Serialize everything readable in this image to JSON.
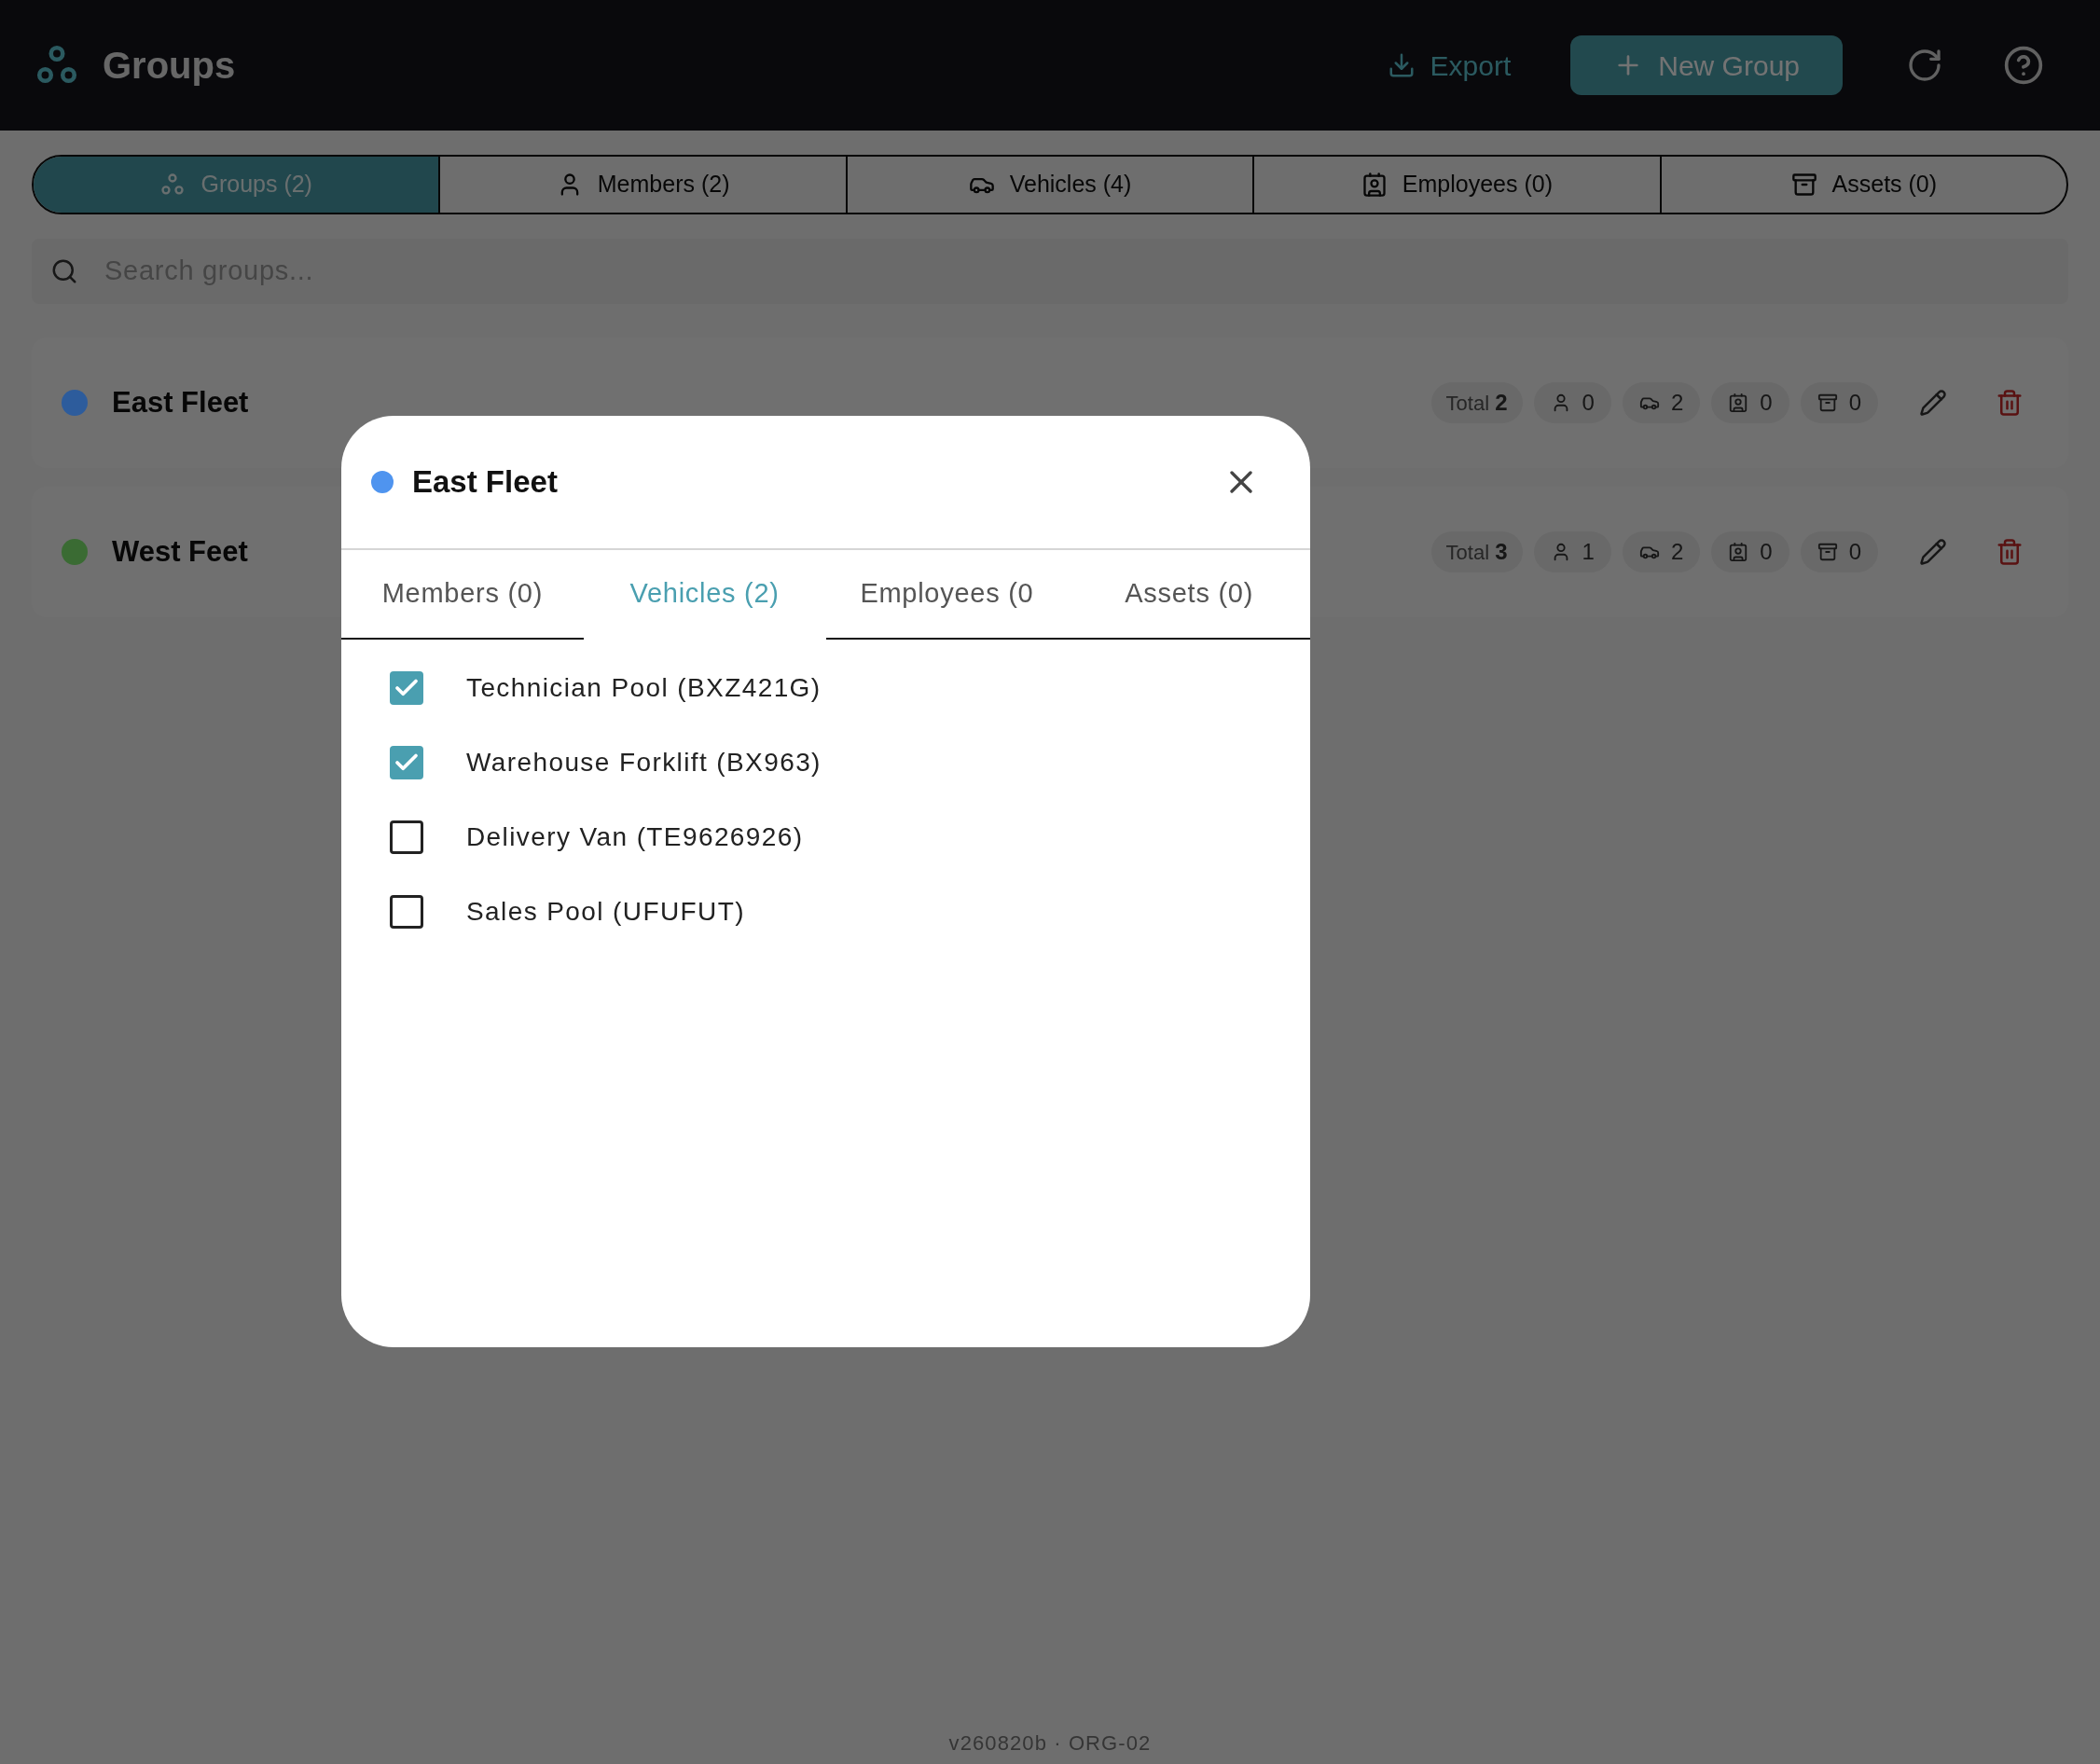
{
  "app": {
    "title": "Groups",
    "export_label": "Export",
    "new_label": "New Group"
  },
  "tabs": [
    {
      "label": "Groups (2)",
      "kind": "groups",
      "selected": true
    },
    {
      "label": "Members (2)",
      "kind": "members",
      "selected": false
    },
    {
      "label": "Vehicles (4)",
      "kind": "vehicles",
      "selected": false
    },
    {
      "label": "Employees (0)",
      "kind": "employees",
      "selected": false
    },
    {
      "label": "Assets (0)",
      "kind": "assets",
      "selected": false
    }
  ],
  "search": {
    "placeholder": "Search groups..."
  },
  "groups": [
    {
      "name": "East Fleet",
      "color": "#2d5c9c",
      "total_label": "Total",
      "total": "2",
      "counts": [
        {
          "kind": "members",
          "value": "0"
        },
        {
          "kind": "vehicles",
          "value": "2"
        },
        {
          "kind": "employees",
          "value": "0"
        },
        {
          "kind": "assets",
          "value": "0"
        }
      ]
    },
    {
      "name": "West Feet",
      "color": "#3a6b33",
      "total_label": "Total",
      "total": "3",
      "counts": [
        {
          "kind": "members",
          "value": "1"
        },
        {
          "kind": "vehicles",
          "value": "2"
        },
        {
          "kind": "employees",
          "value": "0"
        },
        {
          "kind": "assets",
          "value": "0"
        }
      ]
    }
  ],
  "footer": "v260820b · ORG-02",
  "dialog": {
    "title": "East Fleet",
    "color": "#4f94ef",
    "tabs": [
      {
        "label": "Members (0)",
        "selected": false
      },
      {
        "label": "Vehicles (2)",
        "selected": true
      },
      {
        "label": "Employees (0",
        "selected": false
      },
      {
        "label": "Assets (0)",
        "selected": false
      }
    ],
    "items": [
      {
        "label": "Technician Pool (BXZ421G)",
        "checked": true
      },
      {
        "label": "Warehouse Forklift (BX963)",
        "checked": true
      },
      {
        "label": "Delivery Van (TE9626926)",
        "checked": false
      },
      {
        "label": "Sales Pool (UFUFUT)",
        "checked": false
      }
    ]
  }
}
